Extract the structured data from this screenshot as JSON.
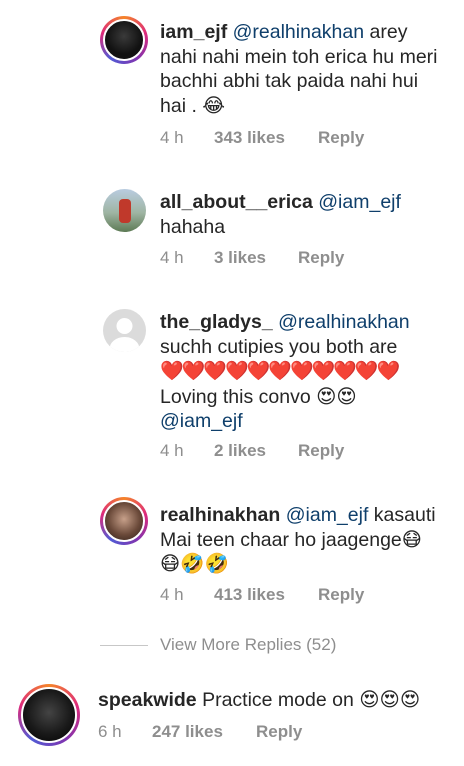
{
  "comments": [
    {
      "user": "iam_ejf",
      "mention": "@realhinakhan",
      "text_lines": [
        "arey",
        "nahi nahi mein toh erica hu meri",
        "bachhi abhi tak paida nahi hui",
        "hai . 😂"
      ],
      "time": "4 h",
      "likes": "343 likes",
      "reply": "Reply"
    },
    {
      "user": "all_about__erica",
      "mention": "@iam_ejf",
      "text_lines": [
        "hahaha"
      ],
      "time": "4 h",
      "likes": "3 likes",
      "reply": "Reply"
    },
    {
      "user": "the_gladys_",
      "mention": "@realhinakhan",
      "text_lines": [
        "suchh cutipies you both are",
        "❤️❤️❤️❤️❤️❤️❤️❤️❤️❤️❤️",
        "Loving this convo 😍😍",
        "@iam_ejf"
      ],
      "time": "4 h",
      "likes": "2 likes",
      "reply": "Reply"
    },
    {
      "user": "realhinakhan",
      "mention": "@iam_ejf",
      "text_lines": [
        "kasauti",
        "Mai teen chaar ho jaagenge😷",
        "😷🤣🤣"
      ],
      "time": "4 h",
      "likes": "413 likes",
      "reply": "Reply"
    }
  ],
  "view_more": "View More Replies (52)",
  "top_comment": {
    "user": "speakwide",
    "text": "Practice mode on 😍😍😍",
    "time": "6 h",
    "likes": "247 likes",
    "reply": "Reply"
  },
  "colors": {
    "mention": "#0f3f6b",
    "meta": "#8e8e8e"
  }
}
